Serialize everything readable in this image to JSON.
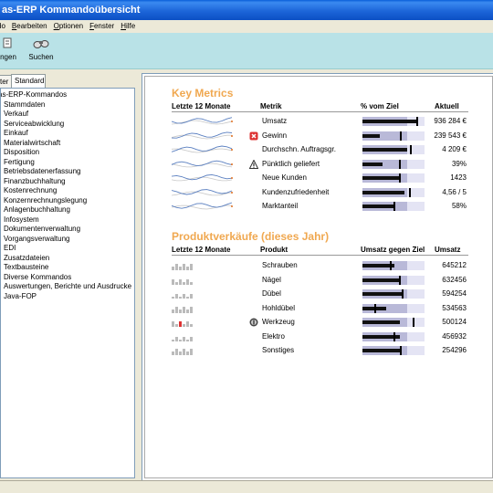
{
  "window": {
    "title": "as-ERP Kommandoübersicht"
  },
  "menu": [
    {
      "pre": "",
      "u": "",
      "post": "do"
    },
    {
      "pre": "",
      "u": "B",
      "post": "earbeiten"
    },
    {
      "pre": "",
      "u": "O",
      "post": "ptionen"
    },
    {
      "pre": "",
      "u": "F",
      "post": "enster"
    },
    {
      "pre": "",
      "u": "H",
      "post": "ilfe"
    }
  ],
  "toolbar": {
    "btn1_label": "ngen",
    "btn2_label": "Suchen"
  },
  "left": {
    "tabs": [
      "ter",
      "Standard"
    ],
    "tree": [
      "as-ERP-Kommandos",
      "Stammdaten",
      "Verkauf",
      "Serviceabwicklung",
      "Einkauf",
      "Materialwirtschaft",
      "Disposition",
      "Fertigung",
      "Betriebsdatenerfassung",
      "Finanzbuchhaltung",
      "Kostenrechnung",
      "Konzernrechnungslegung",
      "Anlagenbuchhaltung",
      "Infosystem",
      "Dokumentenverwaltung",
      "Vorgangsverwaltung",
      "EDI",
      "Zusatzdateien",
      "Textbausteine",
      "Diverse Kommandos",
      "Auswertungen, Berichte und Ausdrucke",
      "Java-FOP"
    ]
  },
  "key_metrics": {
    "title": "Key Metrics",
    "headers": {
      "trend": "Letzte 12 Monate",
      "metric": "Metrik",
      "pct": "% vom Ziel",
      "current": "Aktuell"
    },
    "rows": [
      {
        "metric": "Umsatz",
        "current": "936 284 €",
        "status": "",
        "bar": 0.88,
        "target": 0.88
      },
      {
        "metric": "Gewinn",
        "current": "239 543 €",
        "status": "error-icon",
        "bar": 0.28,
        "target": 0.62
      },
      {
        "metric": "Durchschn. Auftragsgr.",
        "current": "4 209 €",
        "status": "",
        "bar": 0.72,
        "target": 0.78
      },
      {
        "metric": "Pünktlich geliefert",
        "current": "39%",
        "status": "warning-icon",
        "bar": 0.33,
        "target": 0.6
      },
      {
        "metric": "Neue Kunden",
        "current": "1423",
        "status": "",
        "bar": 0.62,
        "target": 0.6
      },
      {
        "metric": "Kundenzufriedenheit",
        "current": "4,56 / 5",
        "status": "",
        "bar": 0.68,
        "target": 0.76
      },
      {
        "metric": "Marktanteil",
        "current": "58%",
        "status": "",
        "bar": 0.52,
        "target": 0.52
      }
    ]
  },
  "product_sales": {
    "title": "Produktverkäufe (dieses Jahr)",
    "headers": {
      "trend": "Letzte 12 Monate",
      "product": "Produkt",
      "vs_target": "Umsatz gegen Ziel",
      "sales": "Umsatz"
    },
    "rows": [
      {
        "product": "Schrauben",
        "sales": "645212",
        "status": "",
        "bar": 0.52,
        "target": 0.45
      },
      {
        "product": "Nägel",
        "sales": "632456",
        "status": "",
        "bar": 0.6,
        "target": 0.6
      },
      {
        "product": "Dübel",
        "sales": "594254",
        "status": "",
        "bar": 0.65,
        "target": 0.65
      },
      {
        "product": "Hohldübel",
        "sales": "534563",
        "status": "",
        "bar": 0.38,
        "target": 0.21
      },
      {
        "product": "Werkzeug",
        "sales": "500124",
        "status": "info-icon",
        "bar": 0.6,
        "target": 0.82
      },
      {
        "product": "Elektro",
        "sales": "456932",
        "status": "",
        "bar": 0.6,
        "target": 0.52
      },
      {
        "product": "Sonstiges",
        "sales": "254296",
        "status": "",
        "bar": 0.6,
        "target": 0.62
      }
    ]
  },
  "colors": {
    "accent": "#f0a850",
    "title_bar": "#1d66d9",
    "toolbar": "#b9e2e7",
    "bullet_good": "#e4e4f4",
    "bullet_mid": "#b9b9d8"
  }
}
